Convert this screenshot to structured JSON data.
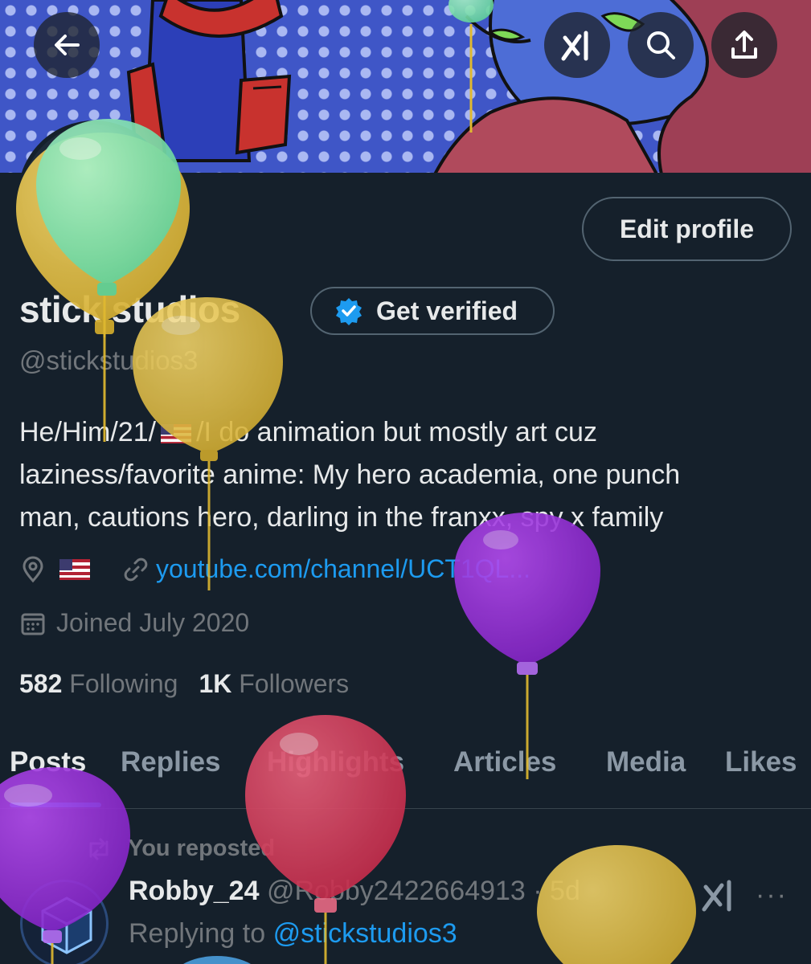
{
  "header": {
    "back_icon": "arrow-left-icon",
    "grok_icon": "grok-icon",
    "search_icon": "search-icon",
    "share_icon": "share-icon"
  },
  "profile": {
    "edit_label": "Edit profile",
    "display_name": "stick studios",
    "verify_label": "Get verified",
    "handle": "@stickstudios3",
    "bio": {
      "line1_start": "He/Him/21/",
      "line1_end": "/I do animation but mostly art cuz",
      "line2": "laziness/favorite anime: My hero academia, one punch",
      "line3": "man, cautions hero, darling in the franxx, spy x family"
    },
    "location_flag": "🇺🇸",
    "link": "youtube.com/channel/UCT1QL...",
    "joined": "Joined July 2020",
    "following_count": "582",
    "following_label": "Following",
    "followers_count": "1K",
    "followers_label": "Followers"
  },
  "tabs": [
    "Posts",
    "Replies",
    "Highlights",
    "Articles",
    "Media",
    "Likes"
  ],
  "post": {
    "repost_label": "You reposted",
    "author": "Robby_24",
    "author_handle_time": "@Robby24226649​13 · 5d",
    "replying_prefix": "Replying to",
    "replying_handle": "@stickstudios3",
    "more_label": "···"
  },
  "colors": {
    "background": "#15202b",
    "accent": "#1d9bf0",
    "text": "#e7e9ea",
    "muted": "#71767b"
  }
}
